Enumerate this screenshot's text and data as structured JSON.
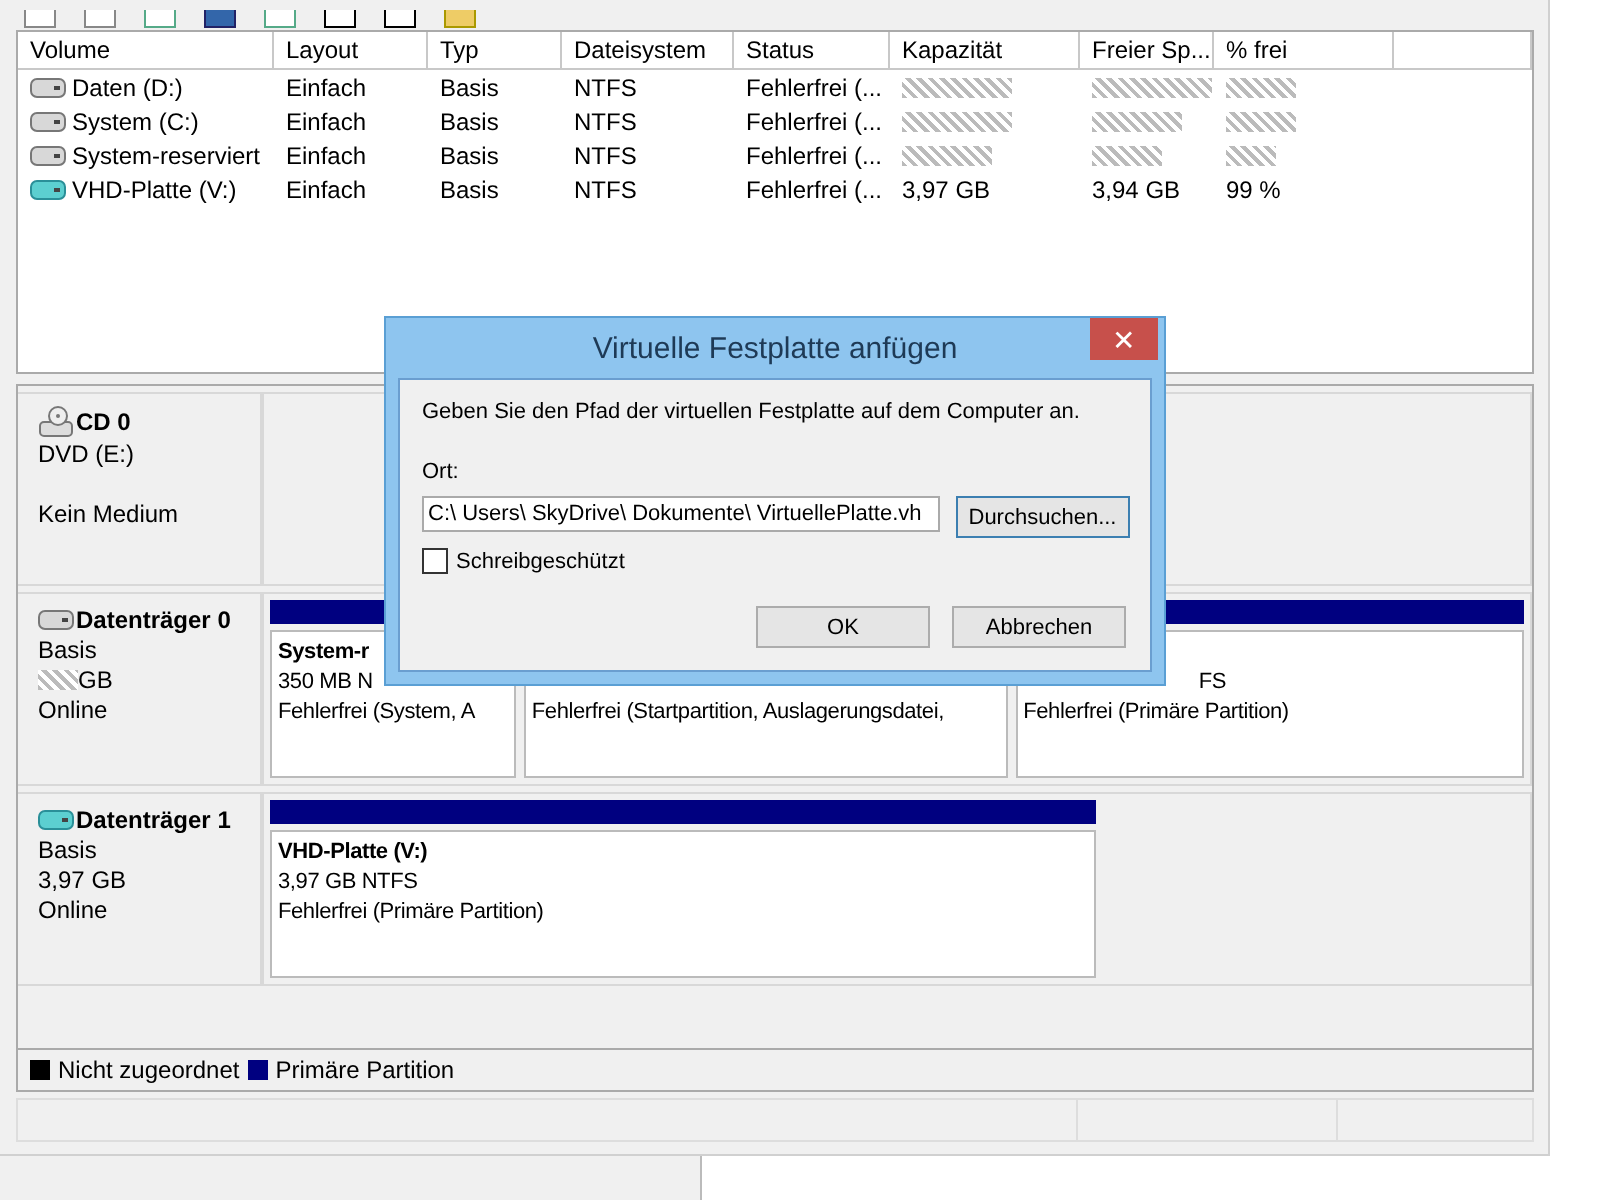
{
  "volume_table": {
    "columns": [
      "Volume",
      "Layout",
      "Typ",
      "Dateisystem",
      "Status",
      "Kapazität",
      "Freier Sp...",
      "% frei"
    ],
    "rows": [
      {
        "kind": "hdd",
        "volume": "Daten (D:)",
        "layout": "Einfach",
        "type": "Basis",
        "filesystem": "NTFS",
        "status": "Fehlerfrei (...",
        "redacted": true
      },
      {
        "kind": "hdd",
        "volume": "System (C:)",
        "layout": "Einfach",
        "type": "Basis",
        "filesystem": "NTFS",
        "status": "Fehlerfrei (...",
        "redacted": true
      },
      {
        "kind": "hdd",
        "volume": "System-reserviert",
        "layout": "Einfach",
        "type": "Basis",
        "filesystem": "NTFS",
        "status": "Fehlerfrei (...",
        "redacted": true
      },
      {
        "kind": "vhd",
        "volume": "VHD-Platte (V:)",
        "layout": "Einfach",
        "type": "Basis",
        "filesystem": "NTFS",
        "status": "Fehlerfrei (...",
        "redacted": false,
        "capacity": "3,97 GB",
        "free": "3,94 GB",
        "percent_free": "99 %"
      }
    ]
  },
  "disks": [
    {
      "kind": "cd",
      "name": "CD 0",
      "lines": [
        "DVD (E:)",
        "Kein Medium"
      ]
    },
    {
      "kind": "hdd",
      "name": "Datenträger 0",
      "lines": [
        "Basis",
        "GB",
        "Online"
      ],
      "size_redacted": true,
      "partitions": [
        {
          "title": "System-r",
          "size": "350 MB N",
          "status": "Fehlerfrei (System, A"
        },
        {
          "status": "Fehlerfrei (Startpartition, Auslagerungsdatei,"
        },
        {
          "size": "FS",
          "status": "Fehlerfrei (Primäre Partition)"
        }
      ]
    },
    {
      "kind": "vhd",
      "name": "Datenträger 1",
      "lines": [
        "Basis",
        "3,97 GB",
        "Online"
      ],
      "size_redacted": false,
      "partitions": [
        {
          "title": "VHD-Platte  (V:)",
          "size": "3,97 GB NTFS",
          "status": "Fehlerfrei (Primäre Partition)"
        }
      ]
    }
  ],
  "legend": [
    {
      "label": "Nicht zugeordnet",
      "color": "#000000"
    },
    {
      "label": "Primäre Partition",
      "color": "#000080"
    }
  ],
  "dialog": {
    "title": "Virtuelle Festplatte anfügen",
    "close_glyph": "✕",
    "instruction": "Geben Sie den Pfad der virtuellen Festplatte auf dem Computer an.",
    "location_label": "Ort:",
    "path_value": "C:\\ Users\\ SkyDrive\\ Dokumente\\ VirtuellePlatte.vh",
    "browse_button": "Durchsuchen...",
    "readonly_checkbox": {
      "label": "Schreibgeschützt",
      "checked": false
    },
    "buttons": [
      "OK",
      "Abbrechen"
    ]
  }
}
